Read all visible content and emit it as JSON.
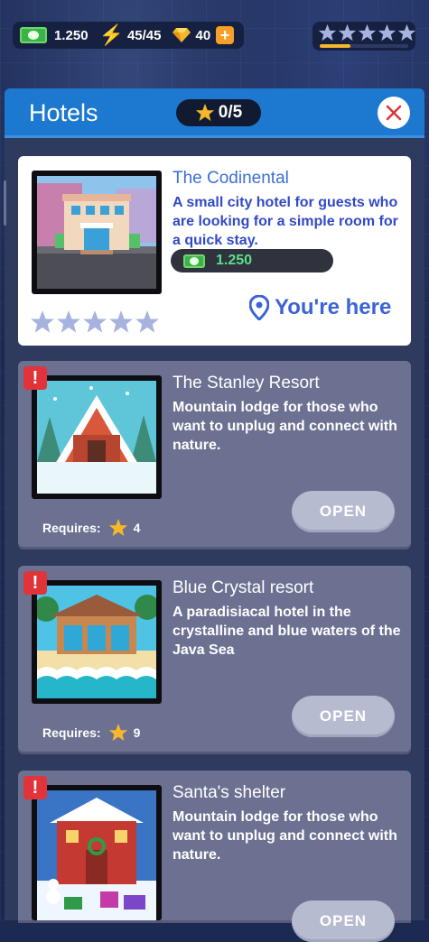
{
  "topbar": {
    "cash": "1.250",
    "energy": "45/45",
    "gems": "40",
    "plus": "+",
    "star_progress": 0.35
  },
  "header": {
    "title": "Hotels",
    "star_count": "0/5"
  },
  "colors": {
    "accent_blue": "#1d78cf",
    "alert_red": "#e0343a",
    "star_yellow": "#f6b72a",
    "money_green": "#58e08a"
  },
  "hotels": [
    {
      "name": "The Codinental",
      "description": "A small city hotel for guests who are looking for a simple room for a quick stay.",
      "price": "1.250",
      "stars": 0,
      "status": "You're here",
      "icon": "location-pin-icon"
    },
    {
      "name": "The Stanley Resort",
      "description": "Mountain lodge for those who want to unplug and connect with nature.",
      "requires_label": "Requires:",
      "requires_stars": "4",
      "button": "OPEN",
      "alert": "!"
    },
    {
      "name": "Blue Crystal resort",
      "description": "A paradisiacal hotel in the crystalline and blue waters of the Java Sea",
      "requires_label": "Requires:",
      "requires_stars": "9",
      "button": "OPEN",
      "alert": "!"
    },
    {
      "name": "Santa's shelter",
      "description": "Mountain lodge for those who want to unplug and connect with nature.",
      "button": "OPEN",
      "alert": "!"
    }
  ]
}
